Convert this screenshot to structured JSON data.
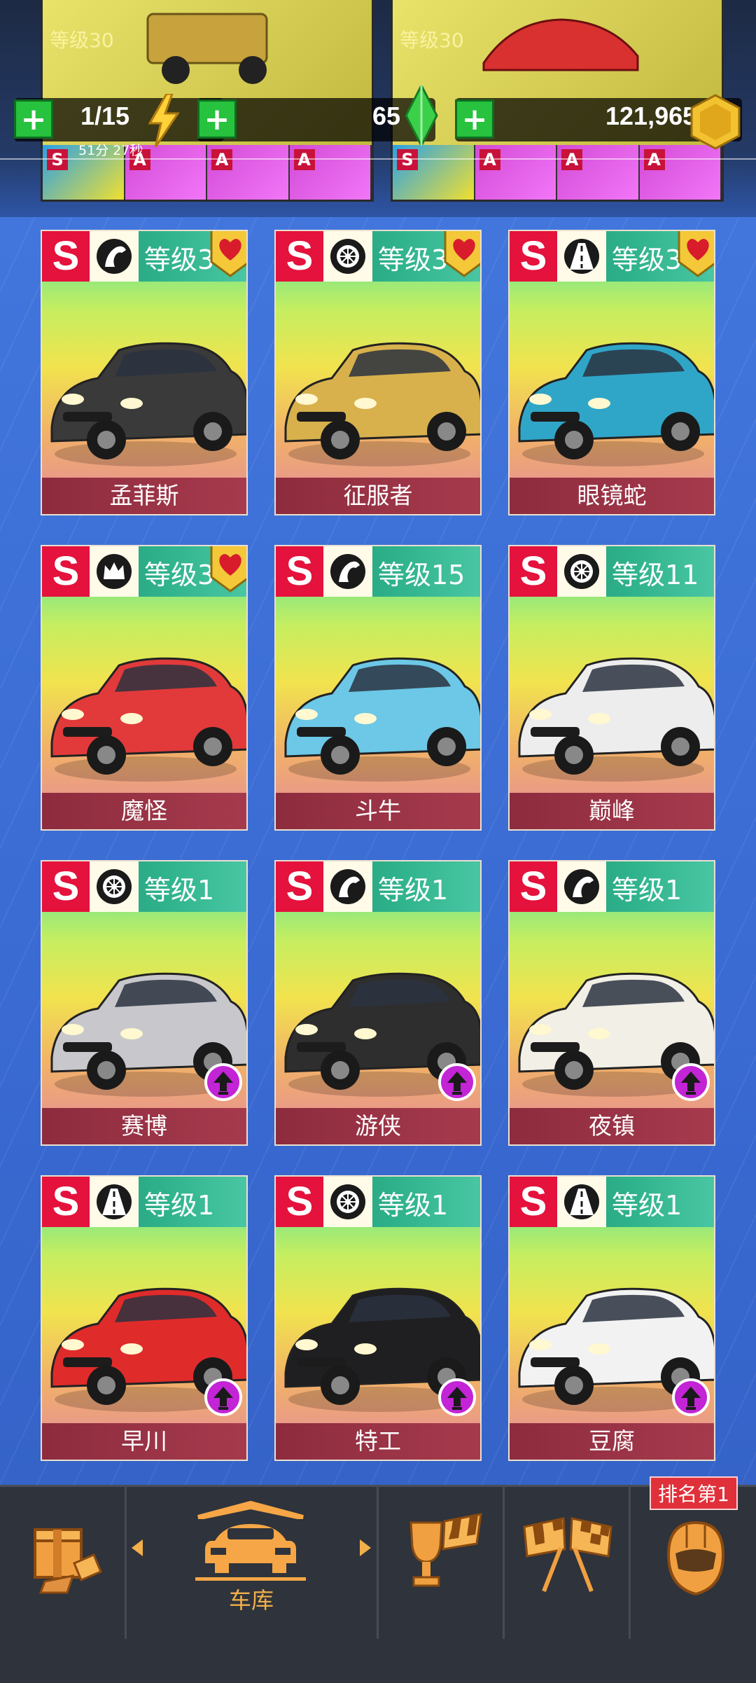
{
  "top_cards": [
    {
      "level_text": "等级30",
      "parts": [
        "S",
        "A",
        "A",
        "A"
      ]
    },
    {
      "level_text": "等级30",
      "parts": [
        "S",
        "A",
        "A",
        "A"
      ]
    }
  ],
  "resources": {
    "energy": "1/15",
    "energy_timer": "51分 27秒",
    "gems": "65",
    "coins": "121,965"
  },
  "cars": [
    {
      "rank": "S",
      "type_icon": "horse-icon",
      "level": "等级3",
      "name": "孟菲斯",
      "favorite": true,
      "upgrade": false,
      "color": "#3a3a3a"
    },
    {
      "rank": "S",
      "type_icon": "wheel-icon",
      "level": "等级3",
      "name": "征服者",
      "favorite": true,
      "upgrade": false,
      "color": "#d8b14c"
    },
    {
      "rank": "S",
      "type_icon": "road-icon",
      "level": "等级3",
      "name": "眼镜蛇",
      "favorite": true,
      "upgrade": false,
      "color": "#2fa6c8"
    },
    {
      "rank": "S",
      "type_icon": "crown-icon",
      "level": "等级3",
      "name": "魔怪",
      "favorite": true,
      "upgrade": false,
      "color": "#e23a3a"
    },
    {
      "rank": "S",
      "type_icon": "horse-icon",
      "level": "等级15",
      "name": "斗牛",
      "favorite": false,
      "upgrade": false,
      "color": "#6cc8e6"
    },
    {
      "rank": "S",
      "type_icon": "wheel-icon",
      "level": "等级11",
      "name": "巅峰",
      "favorite": false,
      "upgrade": false,
      "color": "#ededed"
    },
    {
      "rank": "S",
      "type_icon": "wheel-icon",
      "level": "等级1",
      "name": "赛博",
      "favorite": false,
      "upgrade": true,
      "color": "#c8c8cc"
    },
    {
      "rank": "S",
      "type_icon": "horse-icon",
      "level": "等级1",
      "name": "游侠",
      "favorite": false,
      "upgrade": true,
      "color": "#2e2e2e"
    },
    {
      "rank": "S",
      "type_icon": "horse-icon",
      "level": "等级1",
      "name": "夜镇",
      "favorite": false,
      "upgrade": true,
      "color": "#f1efe6"
    },
    {
      "rank": "S",
      "type_icon": "road-icon",
      "level": "等级1",
      "name": "早川",
      "favorite": false,
      "upgrade": true,
      "color": "#e02b2b"
    },
    {
      "rank": "S",
      "type_icon": "wheel-icon",
      "level": "等级1",
      "name": "特工",
      "favorite": false,
      "upgrade": true,
      "color": "#1f1f22"
    },
    {
      "rank": "S",
      "type_icon": "road-icon",
      "level": "等级1",
      "name": "豆腐",
      "favorite": false,
      "upgrade": true,
      "color": "#f2f2f2"
    }
  ],
  "bottom_nav": {
    "items": [
      {
        "icon": "shop-box-icon"
      },
      {
        "icon": "garage-icon",
        "label": "车库",
        "active": true
      },
      {
        "icon": "trophy-flag-icon"
      },
      {
        "icon": "crossed-flags-icon"
      },
      {
        "icon": "helmet-icon",
        "badge": "排名第1"
      }
    ]
  },
  "colors": {
    "background": "#3d6fd6",
    "rank_s": "#e4123c",
    "name_bar": "#8d2c3e",
    "accent": "#f2b04a",
    "upgrade": "#c224d6"
  }
}
